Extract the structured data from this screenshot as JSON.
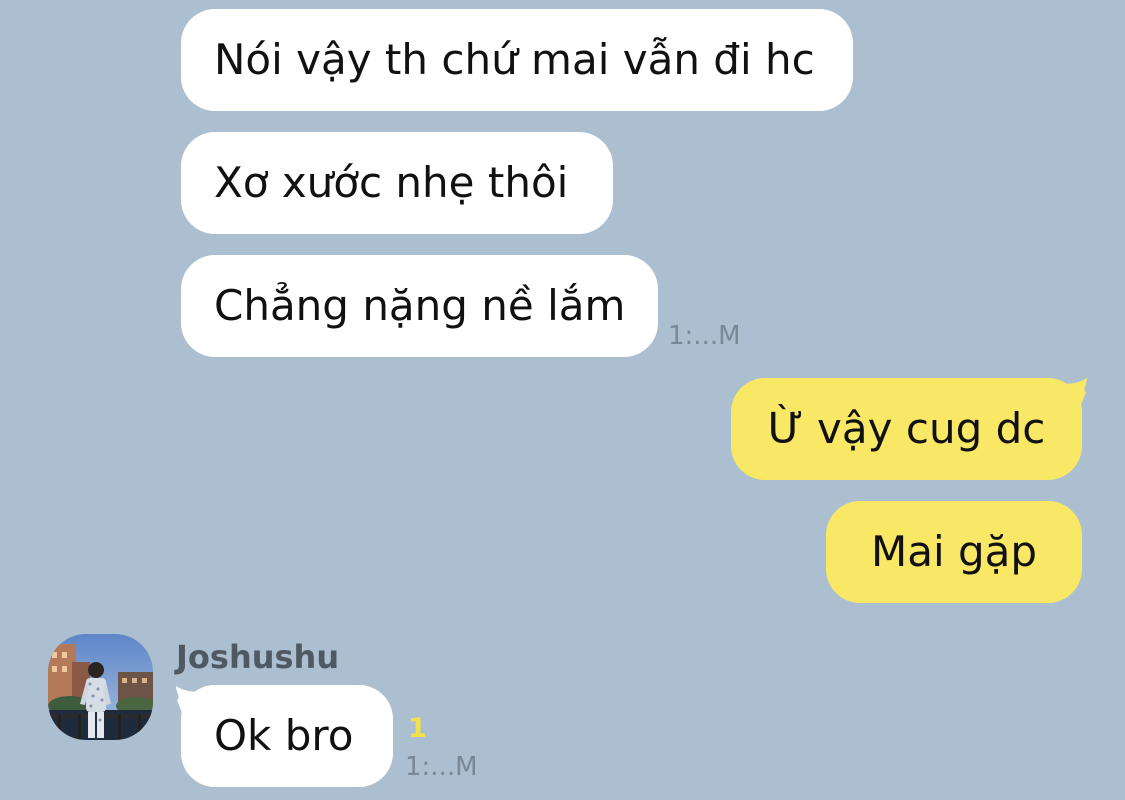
{
  "messages": {
    "incoming_1": {
      "text": "Nói vậy th chứ mai vẫn đi hc"
    },
    "incoming_2": {
      "text": "Xơ xước nhẹ thôi"
    },
    "incoming_3": {
      "text": "Chẳng nặng nề lắm",
      "time": "1:...M"
    },
    "outgoing_1": {
      "text": "Ừ vậy cug dc"
    },
    "outgoing_2": {
      "text": "Mai gặp"
    },
    "incoming_4": {
      "sender": "Joshushu",
      "text": "Ok bro",
      "unread_count": "1",
      "time": "1:...M"
    }
  },
  "colors": {
    "background": "#abbfd0",
    "incoming_bubble": "#ffffff",
    "outgoing_bubble": "#f9e866",
    "unread_count": "#f4e14a"
  },
  "icons": {
    "avatar": "user-photo-avatar"
  }
}
